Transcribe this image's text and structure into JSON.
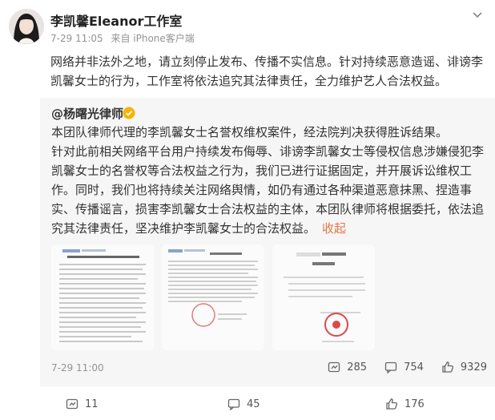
{
  "post": {
    "author": "李凯馨Eleanor工作室",
    "time": "7-29 11:05",
    "source": "来自 iPhone客户端",
    "text": "网络并非法外之地，请立刻停止发布、传播不实信息。针对持续恶意造谣、诽谤李凯馨女士的行为，工作室将依法追究其法律责任，全力维护艺人合法权益。"
  },
  "repost": {
    "author": "@杨曙光律师",
    "paragraphs": [
      "本团队律师代理的李凯馨女士名誉权维权案件，经法院判决获得胜诉结果。",
      "针对此前相关网络平台用户持续发布侮辱、诽谤李凯馨女士等侵权信息涉嫌侵犯李凯馨女士的名誉权等合法权益之行为，我们已进行证据固定，并开展诉讼维权工作。同时，我们也将持续关注网络舆情，如仍有通过各种渠道恶意抹黑、捏造事实、传播谣言，损害李凯馨女士合法权益的主体，本团队律师将根据委托，依法追究其法律责任，坚决维护李凯馨女士的合法权益。"
    ],
    "collapse": "收起",
    "time": "7-29 11:00",
    "reposts": "285",
    "comments": "754",
    "likes": "9329"
  },
  "footer": {
    "reposts": "11",
    "comments": "45",
    "likes": "176"
  },
  "colors": {
    "link": "#eb7340",
    "badge": "#f5b400",
    "quote_bg": "#f6f6f6",
    "meta": "#939393"
  }
}
